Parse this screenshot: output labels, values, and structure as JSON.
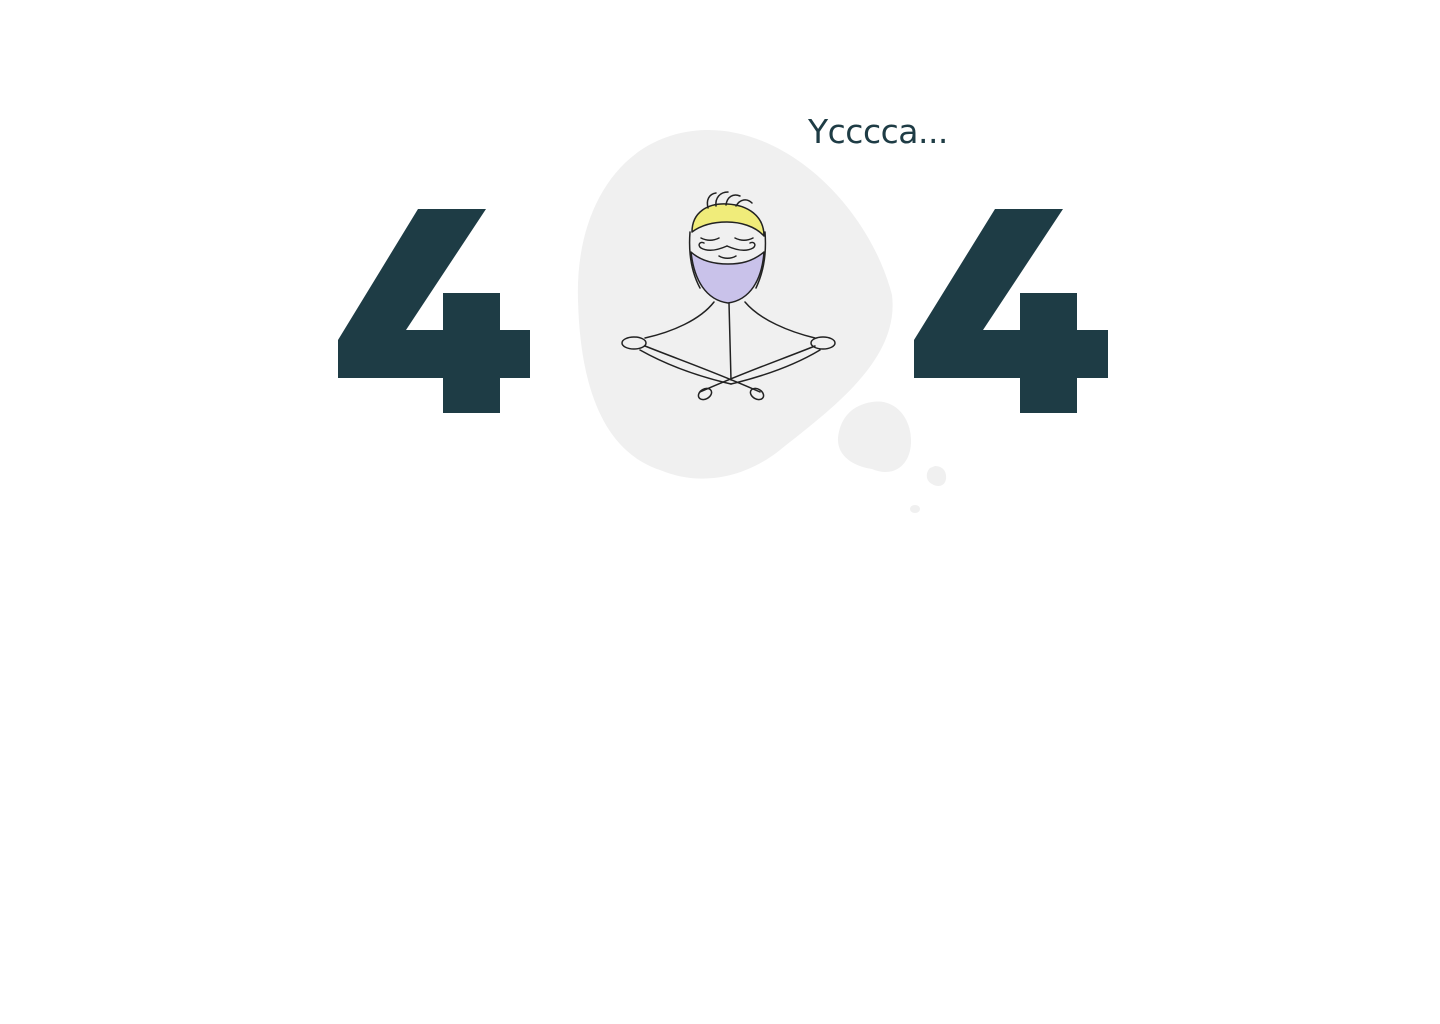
{
  "message": "Ycccca...",
  "colors": {
    "digit": "#1e3c45",
    "text": "#1e3c45",
    "cloud": "#f0f0f0",
    "hair": "#f0ec7a",
    "beard": "#c9c2ea",
    "line": "#222222"
  },
  "illustration": {
    "digits": [
      "4",
      "4"
    ],
    "figure": "meditating-bearded-man"
  }
}
